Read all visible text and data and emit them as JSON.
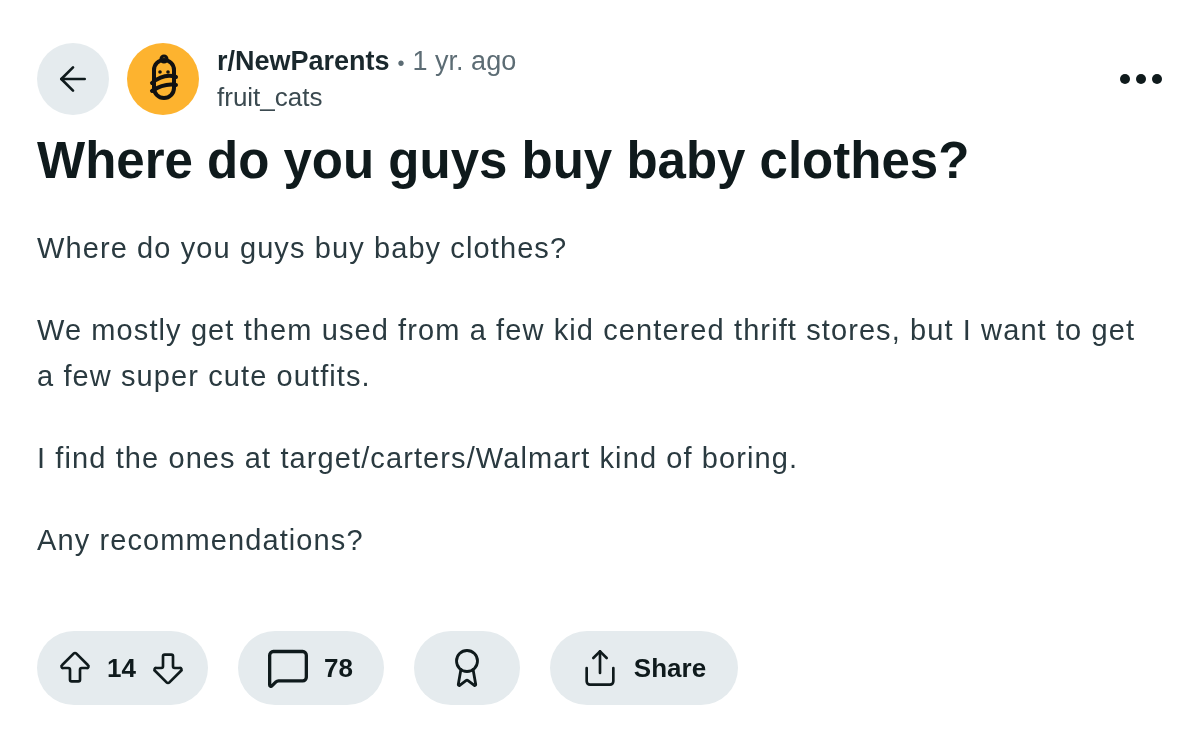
{
  "header": {
    "subreddit": "r/NewParents",
    "separator": "•",
    "time": "1 yr. ago",
    "author": "fruit_cats"
  },
  "post": {
    "title": "Where do you guys buy baby clothes?",
    "paragraphs": [
      "Where do you guys buy baby clothes?",
      "We mostly get them used from a few kid centered thrift stores, but I want to get a few super cute outfits.",
      "I find the ones at target/carters/Walmart kind of boring.",
      "Any recommendations?"
    ]
  },
  "actions": {
    "score": "14",
    "comments": "78",
    "share": "Share"
  }
}
